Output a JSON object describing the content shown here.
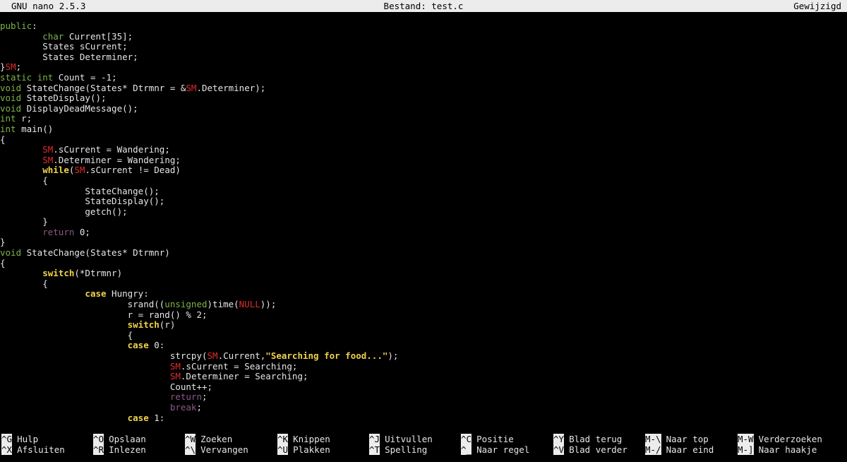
{
  "titlebar": {
    "app": "GNU nano 2.5.3",
    "file": "Bestand: test.c",
    "status": "Gewijzigd"
  },
  "code_lines": [
    [
      [
        "kw-type",
        "public"
      ],
      [
        "",
        ":"
      ]
    ],
    [
      [
        "",
        "        "
      ],
      [
        "kw-type",
        "char"
      ],
      [
        "",
        " Current[35];"
      ]
    ],
    [
      [
        "",
        "        States sCurrent;"
      ]
    ],
    [
      [
        "",
        "        States Determiner;"
      ]
    ],
    [
      [
        "",
        "}"
      ],
      [
        "sm",
        "SM"
      ],
      [
        "",
        ";"
      ]
    ],
    [
      [
        "kw-type",
        "static"
      ],
      [
        "",
        " "
      ],
      [
        "kw-type",
        "int"
      ],
      [
        "",
        " Count = -1;"
      ]
    ],
    [
      [
        "kw-type",
        "void"
      ],
      [
        "",
        " StateChange(States* Dtrmnr = &"
      ],
      [
        "sm",
        "SM"
      ],
      [
        "",
        ".Determiner);"
      ]
    ],
    [
      [
        "kw-type",
        "void"
      ],
      [
        "",
        " StateDisplay();"
      ]
    ],
    [
      [
        "kw-type",
        "void"
      ],
      [
        "",
        " DisplayDeadMessage();"
      ]
    ],
    [
      [
        "kw-type",
        "int"
      ],
      [
        "",
        " r;"
      ]
    ],
    [
      [
        "kw-type",
        "int"
      ],
      [
        "",
        " main()"
      ]
    ],
    [
      [
        "",
        "{"
      ]
    ],
    [
      [
        "",
        "        "
      ],
      [
        "sm",
        "SM"
      ],
      [
        "",
        ".sCurrent = Wandering;"
      ]
    ],
    [
      [
        "",
        "        "
      ],
      [
        "sm",
        "SM"
      ],
      [
        "",
        ".Determiner = Wandering;"
      ]
    ],
    [
      [
        "",
        "        "
      ],
      [
        "kw-ctrl",
        "while"
      ],
      [
        "",
        "("
      ],
      [
        "sm",
        "SM"
      ],
      [
        "",
        ".sCurrent != Dead)"
      ]
    ],
    [
      [
        "",
        "        {"
      ]
    ],
    [
      [
        "",
        "                StateChange();"
      ]
    ],
    [
      [
        "",
        "                StateDisplay();"
      ]
    ],
    [
      [
        "",
        "                getch();"
      ]
    ],
    [
      [
        "",
        "        }"
      ]
    ],
    [
      [
        "",
        "        "
      ],
      [
        "kw-ret",
        "return"
      ],
      [
        "",
        " 0;"
      ]
    ],
    [
      [
        "",
        "}"
      ]
    ],
    [
      [
        "kw-type",
        "void"
      ],
      [
        "",
        " StateChange(States* Dtrmnr)"
      ]
    ],
    [
      [
        "",
        "{"
      ]
    ],
    [
      [
        "",
        "        "
      ],
      [
        "kw-ctrl",
        "switch"
      ],
      [
        "",
        "(*Dtrmnr)"
      ]
    ],
    [
      [
        "",
        "        {"
      ]
    ],
    [
      [
        "",
        "                "
      ],
      [
        "kw-ctrl",
        "case"
      ],
      [
        "",
        " Hungry:"
      ]
    ],
    [
      [
        "",
        "                        srand(("
      ],
      [
        "kw-type",
        "unsigned"
      ],
      [
        "",
        ")time("
      ],
      [
        "sm",
        "NULL"
      ],
      [
        "",
        "));"
      ]
    ],
    [
      [
        "",
        "                        r = rand() % 2;"
      ]
    ],
    [
      [
        "",
        "                        "
      ],
      [
        "kw-ctrl",
        "switch"
      ],
      [
        "",
        "(r)"
      ]
    ],
    [
      [
        "",
        "                        {"
      ]
    ],
    [
      [
        "",
        "                        "
      ],
      [
        "kw-ctrl",
        "case"
      ],
      [
        "",
        " 0:"
      ]
    ],
    [
      [
        "",
        "                                strcpy("
      ],
      [
        "sm",
        "SM"
      ],
      [
        "",
        ".Current,"
      ],
      [
        "str",
        "\"Searching for food...\""
      ],
      [
        "",
        ");"
      ]
    ],
    [
      [
        "",
        "                                "
      ],
      [
        "sm",
        "SM"
      ],
      [
        "",
        ".sCurrent = Searching;"
      ]
    ],
    [
      [
        "",
        "                                "
      ],
      [
        "sm",
        "SM"
      ],
      [
        "",
        ".Determiner = Searching;"
      ]
    ],
    [
      [
        "",
        "                                Count++;"
      ]
    ],
    [
      [
        "",
        "                                "
      ],
      [
        "kw-ret",
        "return"
      ],
      [
        "",
        ";"
      ]
    ],
    [
      [
        "",
        "                                "
      ],
      [
        "kw-ret",
        "break"
      ],
      [
        "",
        ";"
      ]
    ],
    [
      [
        "",
        "                        "
      ],
      [
        "kw-ctrl",
        "case"
      ],
      [
        "",
        " 1:"
      ]
    ]
  ],
  "shortcuts": {
    "row1": [
      {
        "key": "^G",
        "label": "Hulp"
      },
      {
        "key": "^O",
        "label": "Opslaan"
      },
      {
        "key": "^W",
        "label": "Zoeken"
      },
      {
        "key": "^K",
        "label": "Knippen"
      },
      {
        "key": "^J",
        "label": "Uitvullen"
      },
      {
        "key": "^C",
        "label": "Positie"
      },
      {
        "key": "^Y",
        "label": "Blad terug"
      },
      {
        "key": "M-\\",
        "label": "Naar top"
      },
      {
        "key": "M-W",
        "label": "Verderzoeken"
      }
    ],
    "row2": [
      {
        "key": "^X",
        "label": "Afsluiten"
      },
      {
        "key": "^R",
        "label": "Inlezen"
      },
      {
        "key": "^\\",
        "label": "Vervangen"
      },
      {
        "key": "^U",
        "label": "Plakken"
      },
      {
        "key": "^T",
        "label": "Spelling"
      },
      {
        "key": "^_",
        "label": "Naar regel"
      },
      {
        "key": "^V",
        "label": "Blad verder"
      },
      {
        "key": "M-/",
        "label": "Naar eind"
      },
      {
        "key": "M-]",
        "label": "Naar haakje"
      }
    ]
  },
  "colors": {
    "background": "#000000",
    "titlebar": "#ececec",
    "type_keyword": "#7fb24a",
    "control_keyword": "#f0d24a",
    "return_keyword": "#8a5a86",
    "macro_red": "#e02c2c",
    "string": "#f0d24a"
  }
}
